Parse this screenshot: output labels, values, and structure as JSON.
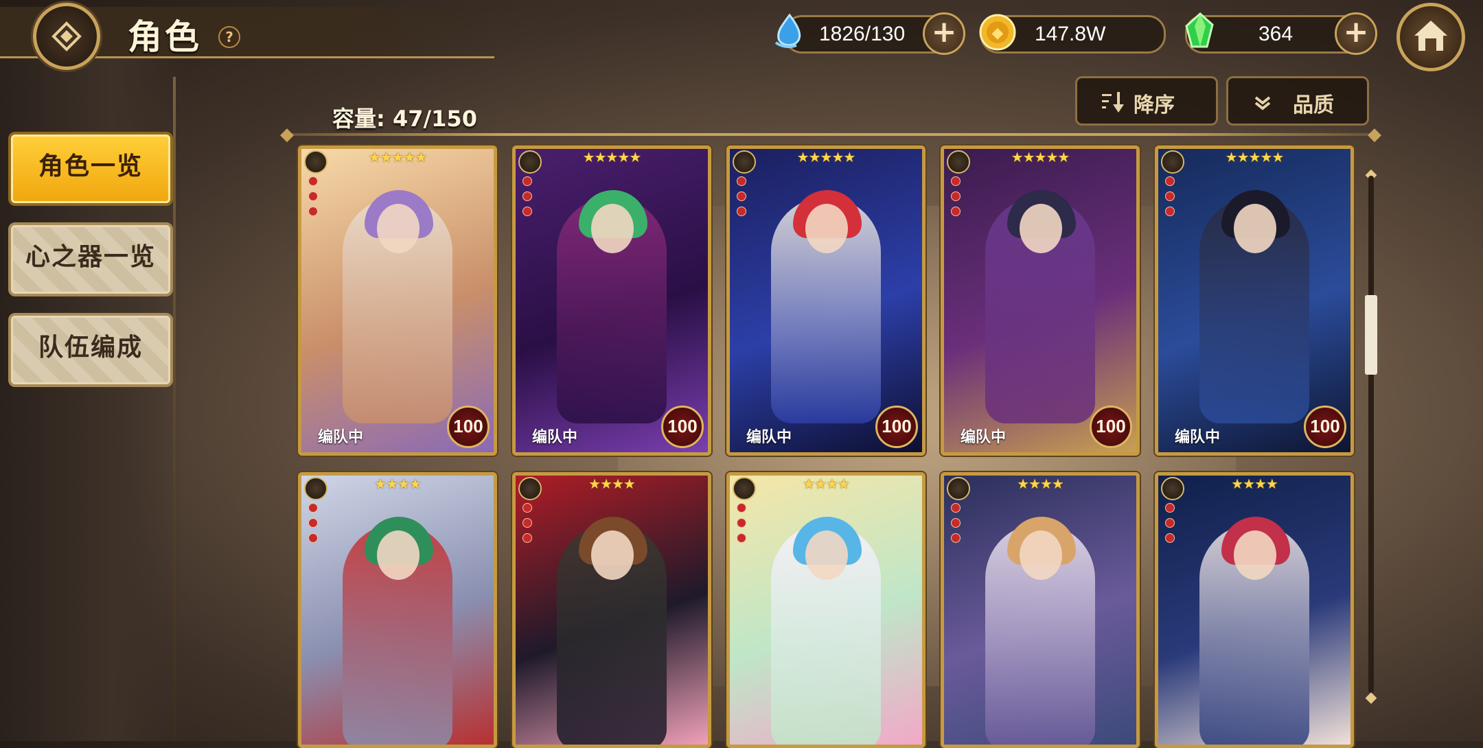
{
  "header": {
    "title": "角色",
    "help_icon": "?",
    "resources": [
      {
        "name": "stamina",
        "icon": "water-drop-icon",
        "value": "1826/130",
        "has_plus": true
      },
      {
        "name": "gold",
        "icon": "gold-coin-icon",
        "value": "147.8W",
        "has_plus": false
      },
      {
        "name": "gem",
        "icon": "green-crystal-icon",
        "value": "364",
        "has_plus": true
      }
    ],
    "plus_label": "+"
  },
  "sidebar": {
    "items": [
      {
        "label": "角色一览",
        "active": true
      },
      {
        "label": "心之器一览",
        "active": false
      },
      {
        "label": "队伍编成",
        "active": false
      }
    ]
  },
  "main": {
    "capacity": "容量: 47/150",
    "sort_label": "降序",
    "filter_label": "品质"
  },
  "cards": [
    {
      "stars": "★★★★★",
      "status": "编队中",
      "level": "100",
      "palette": [
        "#f7d9a8",
        "#c98f6a",
        "#8a6ab8"
      ],
      "hair": "#9b7ac8",
      "outfit": "#e9ddd0"
    },
    {
      "stars": "★★★★★",
      "status": "编队中",
      "level": "100",
      "palette": [
        "#4a1f6e",
        "#2a0f45",
        "#7a3fb0"
      ],
      "hair": "#3bb06a",
      "outfit": "#8b2a7a"
    },
    {
      "stars": "★★★★★",
      "status": "编队中",
      "level": "100",
      "palette": [
        "#1c1f5e",
        "#2c3fa8",
        "#0e0f30"
      ],
      "hair": "#d4303a",
      "outfit": "#f2ece4"
    },
    {
      "stars": "★★★★★",
      "status": "编队中",
      "level": "100",
      "palette": [
        "#3a1c4e",
        "#6a2f7a",
        "#c8a050"
      ],
      "hair": "#2d2a4a",
      "outfit": "#6a3a8e"
    },
    {
      "stars": "★★★★★",
      "status": "编队中",
      "level": "100",
      "palette": [
        "#162a5a",
        "#2b4c9a",
        "#0e1530"
      ],
      "hair": "#1a1a2a",
      "outfit": "#2a2a3e"
    },
    {
      "stars": "★★★★",
      "status": "",
      "level": "",
      "palette": [
        "#cfd6e6",
        "#8a8fb0",
        "#b83030"
      ],
      "hair": "#2f8f5a",
      "outfit": "#c62f2f"
    },
    {
      "stars": "★★★★",
      "status": "",
      "level": "",
      "palette": [
        "#b01d26",
        "#1e1a2a",
        "#f0a0b8"
      ],
      "hair": "#7a4a2a",
      "outfit": "#3a3a30"
    },
    {
      "stars": "★★★★",
      "status": "",
      "level": "",
      "palette": [
        "#f6e6a8",
        "#bfe6c8",
        "#f2a8c8"
      ],
      "hair": "#57b6e6",
      "outfit": "#f7f0ff"
    },
    {
      "stars": "★★★★",
      "status": "",
      "level": "",
      "palette": [
        "#2a2f5a",
        "#6a5a9a",
        "#3c4a7a"
      ],
      "hair": "#d8a46a",
      "outfit": "#efe6f2"
    },
    {
      "stars": "★★★★",
      "status": "",
      "level": "",
      "palette": [
        "#10204a",
        "#2a3a7a",
        "#f0e0d8"
      ],
      "hair": "#c2304a",
      "outfit": "#f2e8e8"
    }
  ]
}
